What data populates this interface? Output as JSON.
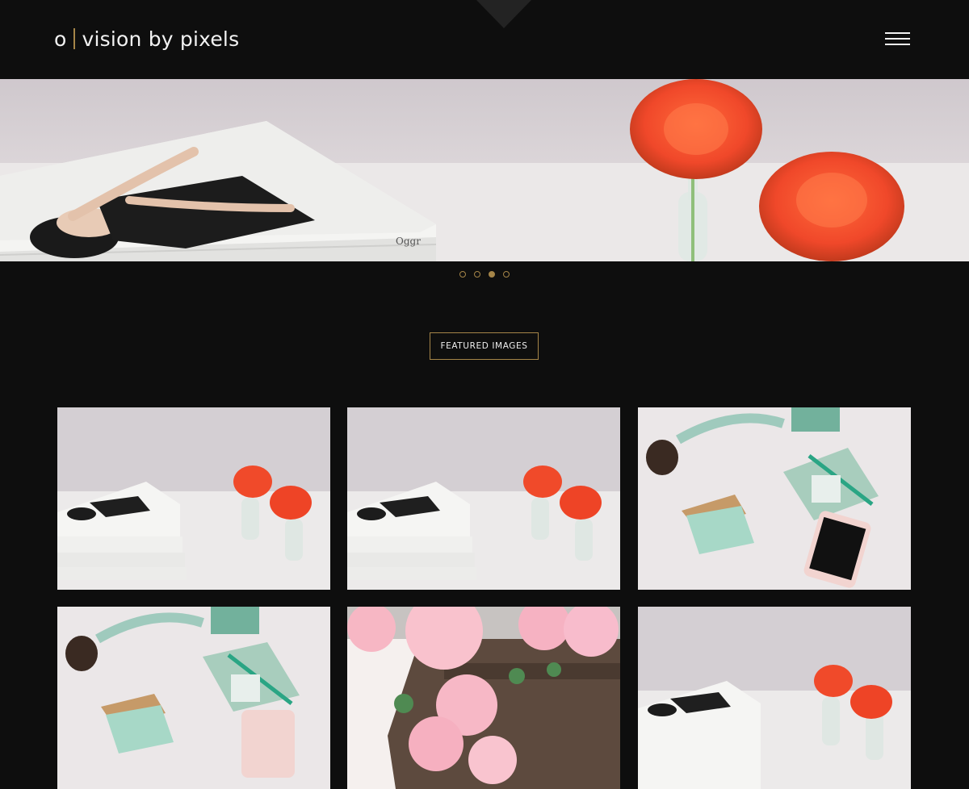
{
  "header": {
    "logo_mark": "o",
    "logo_text": "vision by pixels",
    "menu_icon": "hamburger-menu-icon"
  },
  "hero": {
    "slide_count": 4,
    "active_slide": 3
  },
  "featured": {
    "label": "FEATURED IMAGES"
  },
  "gallery": {
    "items": [
      {
        "subject": "books-and-tulips"
      },
      {
        "subject": "books-and-tulips"
      },
      {
        "subject": "stationery-and-phone"
      },
      {
        "subject": "stationery-and-phone"
      },
      {
        "subject": "pink-carnations"
      },
      {
        "subject": "books-and-tulips"
      }
    ]
  },
  "colors": {
    "background": "#0e0e0e",
    "accent": "#a58548",
    "text": "#f2f2f2"
  }
}
